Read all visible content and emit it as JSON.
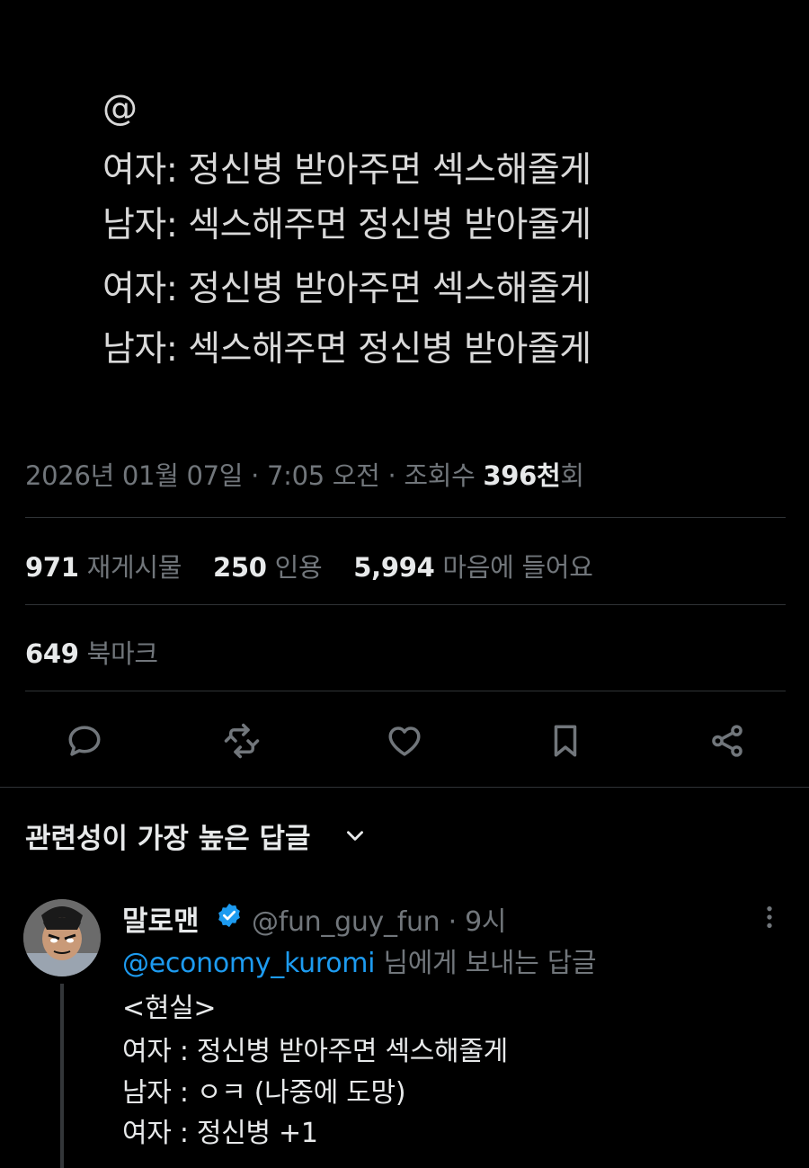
{
  "tweet": {
    "quote_lines": [
      "@",
      "여자: 정신병 받아주면 섹스해줄게",
      "남자: 섹스해주면 정신병 받아줄게",
      "여자: 정신병 받아주면 섹스해줄게",
      "남자: 섹스해주면 정신병 받아줄게"
    ],
    "date": "2026년 01월 07일",
    "sep": " · ",
    "time": "7:05 오전",
    "views_label": "조회수 ",
    "views_value": "396천",
    "views_suffix": "회"
  },
  "stats": {
    "reposts_count": "971",
    "reposts_label": "재게시물",
    "quotes_count": "250",
    "quotes_label": "인용",
    "likes_count": "5,994",
    "likes_label": "마음에 들어요",
    "bookmarks_count": "649",
    "bookmarks_label": "북마크"
  },
  "actions": [
    "reply-icon",
    "repost-icon",
    "like-icon",
    "bookmark-icon",
    "share-icon"
  ],
  "replies": {
    "heading": "관련성이 가장 높은 답글",
    "first": {
      "name": "말로맨",
      "handle_time": "@fun_guy_fun · 9시",
      "reply_to_mention": "@economy_kuromi",
      "reply_to_suffix": " 님에게 보내는 답글",
      "lines": [
        "<현실>",
        "여자 : 정신병 받아주면 섹스해줄게",
        "남자 : ㅇㅋ (나중에 도망)",
        "여자 : 정신병 +1"
      ]
    }
  },
  "colors": {
    "accent": "#1d9bf0",
    "muted": "#71767b",
    "text": "#e7e9ea",
    "divider": "#2f3336"
  }
}
